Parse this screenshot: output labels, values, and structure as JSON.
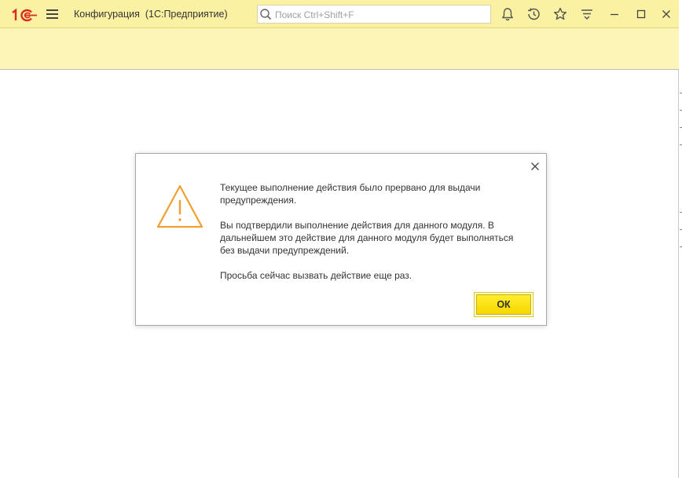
{
  "window": {
    "title": "Конфигурация  (1С:Предприятие)",
    "logo": "1С"
  },
  "search": {
    "placeholder": "Поиск Ctrl+Shift+F",
    "value": ""
  },
  "toolbar": {
    "icons": [
      "bell-icon",
      "history-icon",
      "star-icon",
      "filter-menu-icon",
      "minimize-icon",
      "maximize-icon",
      "close-icon"
    ]
  },
  "dialog": {
    "icon": "warning-icon",
    "message1": "Текущее выполнение действия было прервано для выдачи предупреждения.",
    "message2": "Вы подтвердили выполнение действия для данного модуля. В дальнейшем это действие для данного модуля будет выполняться без выдачи предупреждений.",
    "message3": "Просьба сейчас вызвать действие еще раз.",
    "ok_label": "ОК"
  },
  "colors": {
    "titlebar": "#fbf1a3",
    "subbar": "#fdf4b8",
    "accent_button": "#f8dc00",
    "logo_red": "#d92b1f",
    "warning_orange": "#f0a030"
  }
}
